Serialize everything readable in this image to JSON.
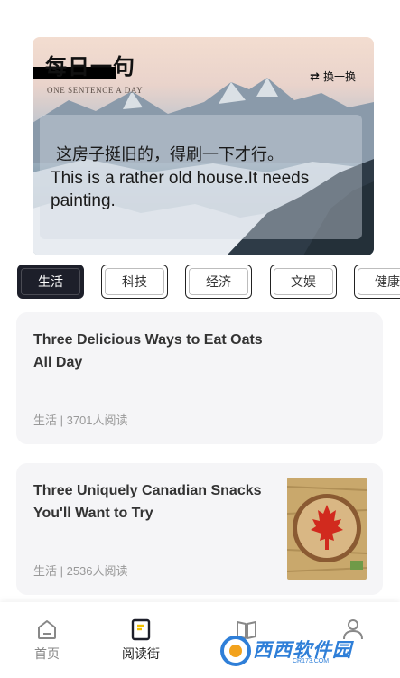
{
  "banner": {
    "title": "每日一句",
    "subtitle": "ONE SENTENCE A DAY",
    "switch_label": "换一换",
    "switch_icon": "⇄",
    "quote_cn": "这房子挺旧的，得刷一下才行。",
    "quote_en": "This is a rather old house.It needs painting."
  },
  "tabs": [
    {
      "label": "生活",
      "active": true
    },
    {
      "label": "科技",
      "active": false
    },
    {
      "label": "经济",
      "active": false
    },
    {
      "label": "文娱",
      "active": false
    },
    {
      "label": "健康",
      "active": false
    }
  ],
  "articles": [
    {
      "title": "Three Delicious Ways to Eat Oats All Day",
      "meta": "生活 | 3701人阅读",
      "has_thumb": false
    },
    {
      "title": "Three Uniquely Canadian Snacks You'll Want to Try",
      "meta": "生活 | 2536人阅读",
      "has_thumb": true
    }
  ],
  "nav": [
    {
      "label": "首页",
      "icon": "home-icon",
      "active": false
    },
    {
      "label": "阅读街",
      "icon": "book-icon",
      "active": true
    },
    {
      "label": "",
      "icon": "open-book-icon",
      "active": false
    },
    {
      "label": "",
      "icon": "user-icon",
      "active": false
    }
  ],
  "watermark": {
    "text": "西西软件园",
    "sub": "CR173.COM"
  },
  "colors": {
    "tab_active_bg": "#1d1f2a",
    "card_bg": "#f5f5f7",
    "watermark": "#2f7fd8"
  }
}
